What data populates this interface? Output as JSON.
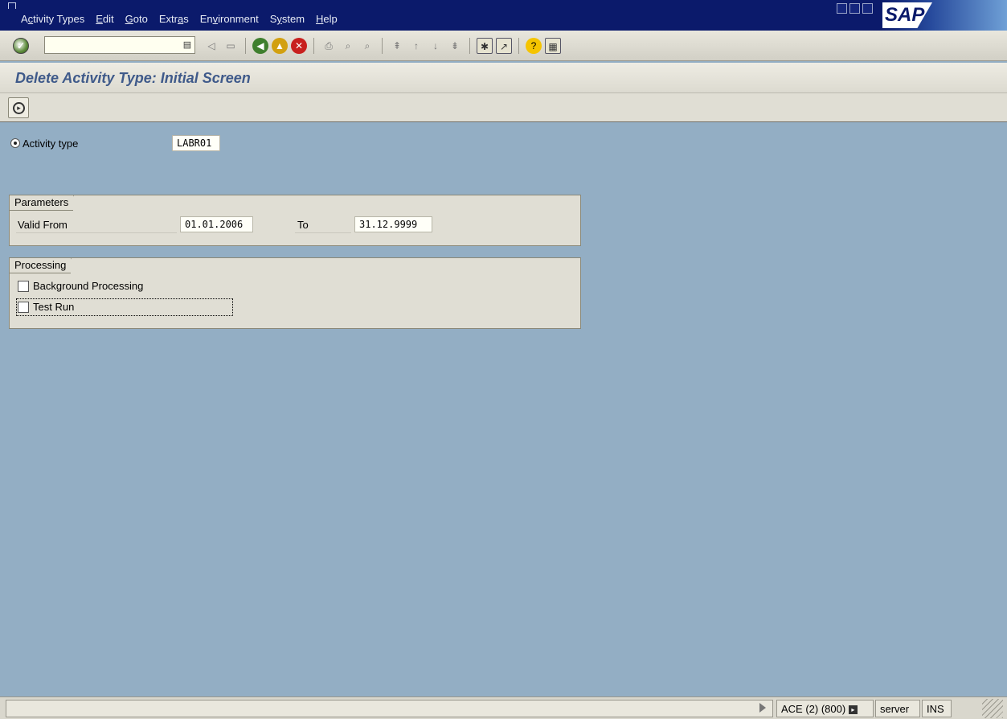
{
  "menubar": {
    "items": [
      {
        "pre": "A",
        "u": "c",
        "post": "tivity Types"
      },
      {
        "pre": "",
        "u": "E",
        "post": "dit"
      },
      {
        "pre": "",
        "u": "G",
        "post": "oto"
      },
      {
        "pre": "Extr",
        "u": "a",
        "post": "s"
      },
      {
        "pre": "En",
        "u": "v",
        "post": "ironment"
      },
      {
        "pre": "S",
        "u": "y",
        "post": "stem"
      },
      {
        "pre": "",
        "u": "H",
        "post": "elp"
      }
    ],
    "logo": "SAP"
  },
  "toolbar": {
    "command_field_value": "",
    "icons": [
      "enter-icon",
      "save-icon",
      "back-icon",
      "exit-icon",
      "cancel-icon",
      "print-icon",
      "find-icon",
      "find-next-icon",
      "first-page-icon",
      "previous-page-icon",
      "next-page-icon",
      "last-page-icon",
      "new-session-icon",
      "shortcut-icon",
      "help-icon",
      "layout-menu-icon"
    ]
  },
  "screen": {
    "title": "Delete Activity Type: Initial Screen"
  },
  "form": {
    "activity_type": {
      "label": "Activity type",
      "value": "LABR01"
    },
    "parameters": {
      "title": "Parameters",
      "valid_from_label": "Valid From",
      "valid_from_value": "01.01.2006",
      "to_label": "To",
      "to_value": "31.12.9999"
    },
    "processing": {
      "title": "Processing",
      "background_label": "Background Processing",
      "background_checked": false,
      "test_run_label": "Test Run",
      "test_run_checked": false
    }
  },
  "statusbar": {
    "system": "ACE (2) (800)",
    "server": "server",
    "mode": "INS"
  }
}
